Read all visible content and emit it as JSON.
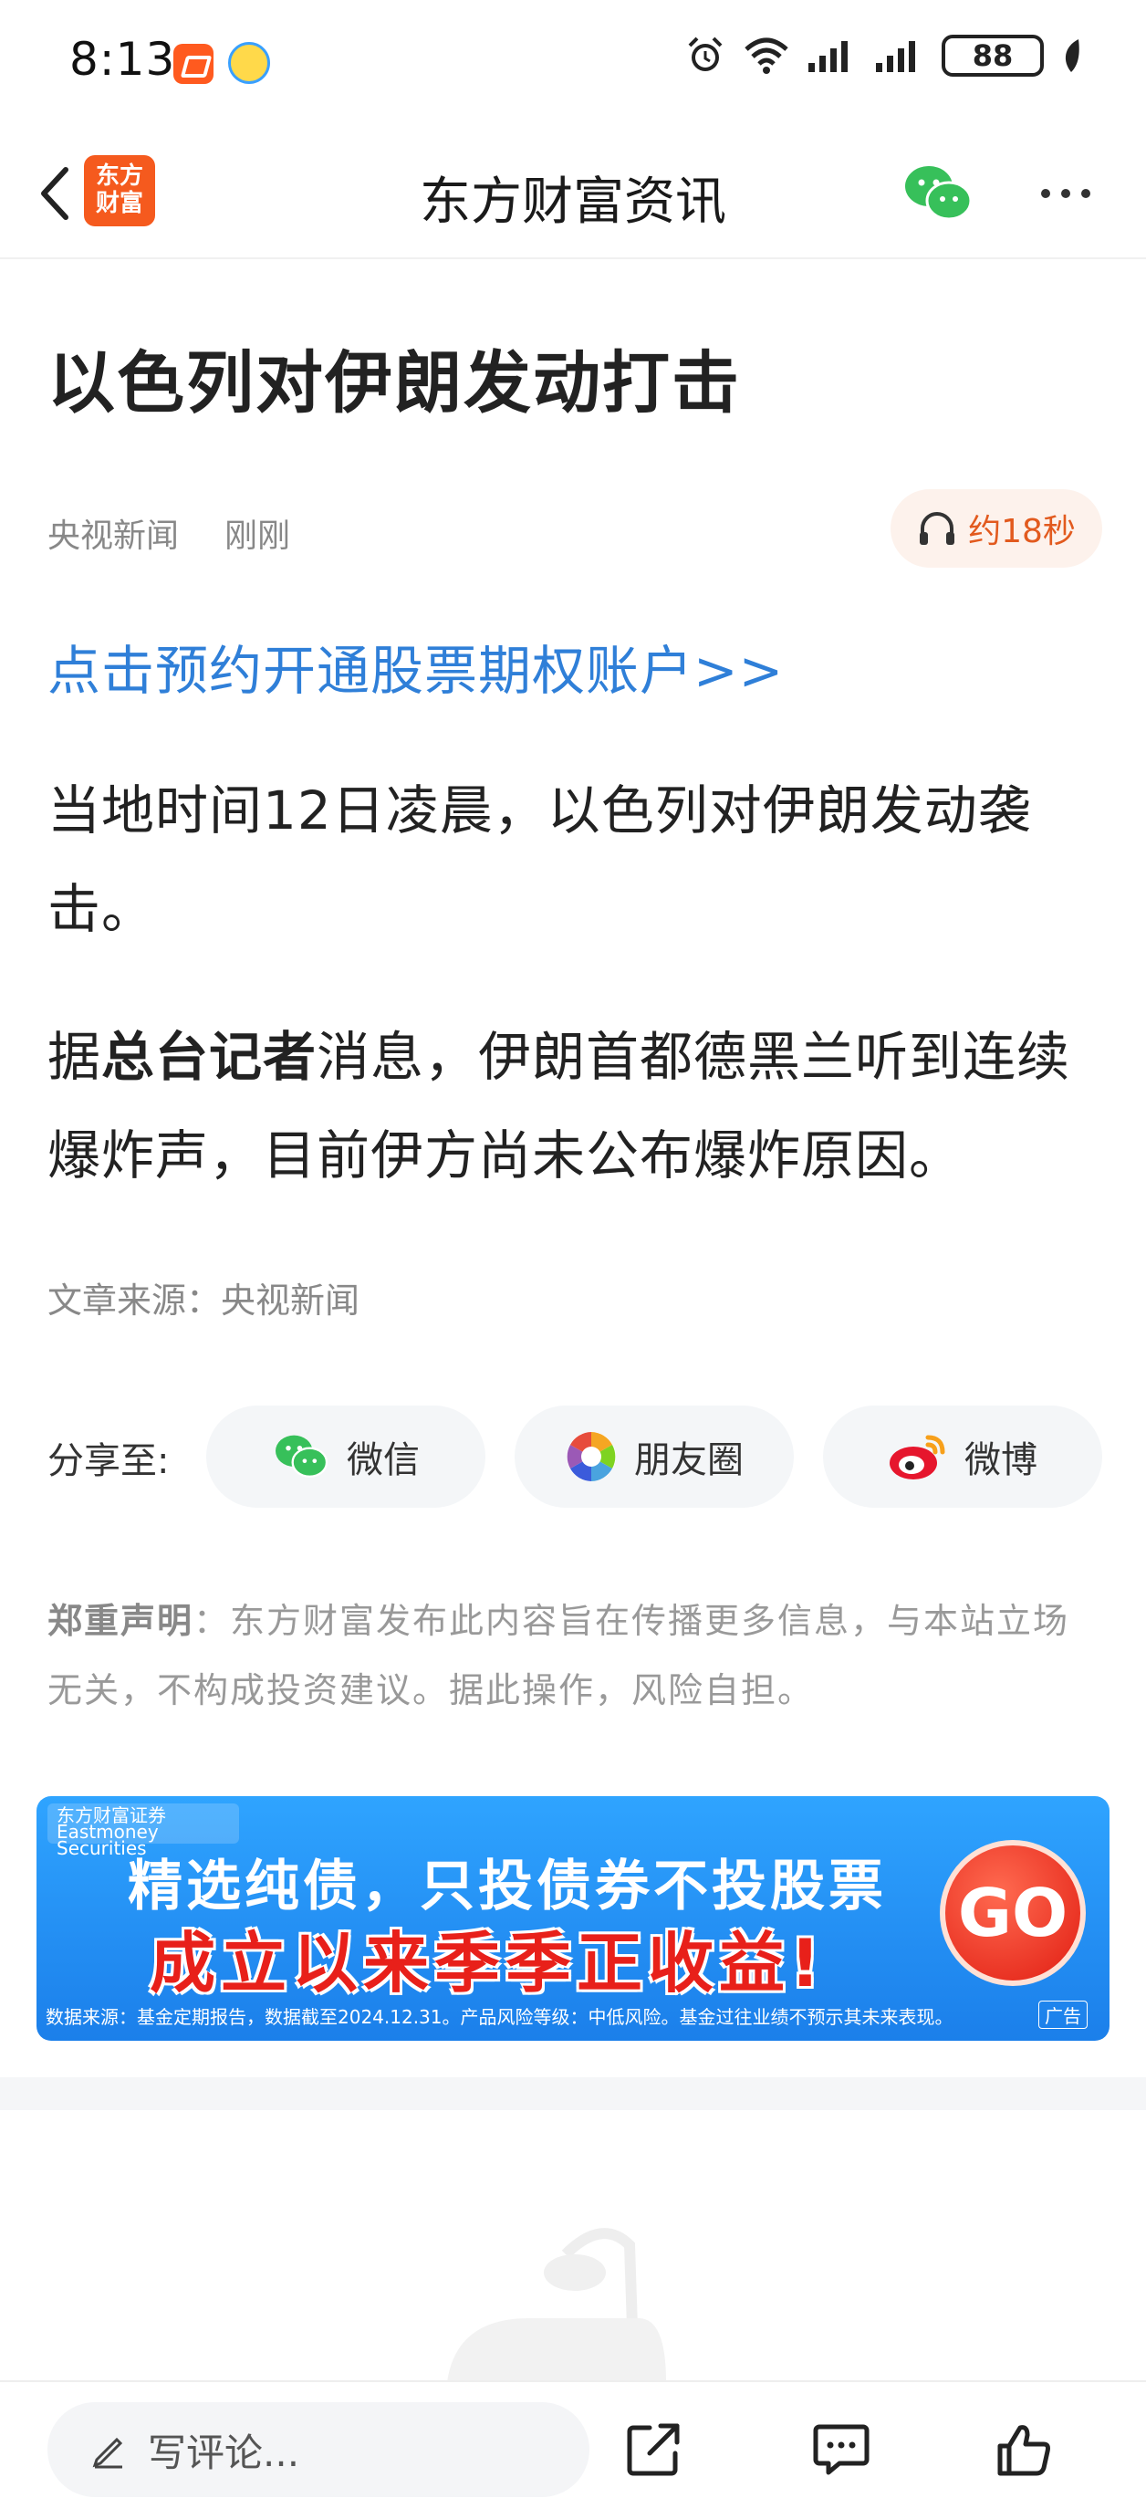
{
  "status_bar": {
    "time": "8:13",
    "battery": "88"
  },
  "header": {
    "title": "东方财富资讯",
    "logo_line1": "东方",
    "logo_line2": "财富"
  },
  "article": {
    "title": "以色列对伊朗发动打击",
    "source": "央视新闻",
    "time": "刚刚",
    "listen_label": "约18秒",
    "promo_link": "点击预约开通股票期权账户>>",
    "para1": "当地时间12日凌晨，以色列对伊朗发动袭击。",
    "para2_prefix": "据",
    "para2_bold": "总台记者",
    "para2_rest": "消息，伊朗首都德黑兰听到连续爆炸声，目前伊方尚未公布爆炸原因。",
    "source_line": "文章来源：央视新闻"
  },
  "share": {
    "label": "分享至:",
    "buttons": [
      {
        "label": "微信",
        "icon": "wechat-icon"
      },
      {
        "label": "朋友圈",
        "icon": "moments-icon"
      },
      {
        "label": "微博",
        "icon": "weibo-icon"
      }
    ]
  },
  "disclaimer": {
    "title": "郑重声明",
    "text": "：东方财富发布此内容旨在传播更多信息，与本站立场无关，不构成投资建议。据此操作，风险自担。"
  },
  "ad": {
    "brand": "东方财富证券 Eastmoney Securities",
    "line1": "精选纯债，只投债券不投股票",
    "line2": "成立以来季季正收益!",
    "cta": "GO",
    "footnote": "数据来源：基金定期报告，数据截至2024.12.31。产品风险等级：中低风险。基金过往业绩不预示其未来表现。",
    "tag": "广告"
  },
  "bottom_bar": {
    "comment_placeholder": "写评论..."
  },
  "colors": {
    "accent": "#2f7fd8",
    "brand": "#f55a1e",
    "listen": "#e25a1e"
  }
}
